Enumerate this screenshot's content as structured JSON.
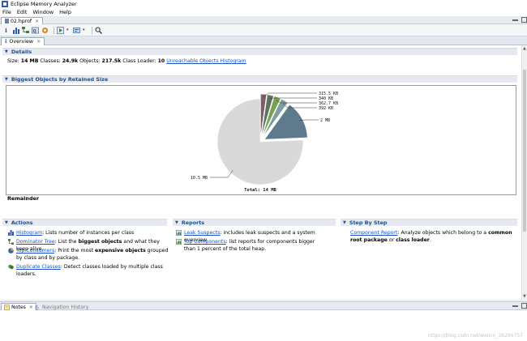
{
  "window": {
    "title": "Eclipse Memory Analyzer"
  },
  "menu": [
    "File",
    "Edit",
    "Window",
    "Help"
  ],
  "file_tab": {
    "label": "02.hprof"
  },
  "overview_tab": {
    "label": "Overview"
  },
  "details": {
    "header": "Details",
    "size_label": "Size:",
    "size_value": "14 MB",
    "classes_label": "Classes:",
    "classes_value": "24.9k",
    "objects_label": "Objects:",
    "objects_value": "217.5k",
    "loader_label": "Class Loader:",
    "loader_value": "10",
    "unreachable_link": "Unreachable Objects Histogram"
  },
  "biggest": {
    "header": "Biggest Objects by Retained Size",
    "remainder_label": "Remainder"
  },
  "chart_data": {
    "type": "pie",
    "total_label": "Total: 14 MB",
    "slices": [
      {
        "label": "10.5 MB",
        "value": 10.5,
        "color": "#d9d9d9",
        "exploded": false
      },
      {
        "label": "2 MB",
        "value": 2.0,
        "color": "#5f7a8c",
        "exploded": true
      },
      {
        "label": "392 KB",
        "value": 0.383,
        "color": "#7d9ea0",
        "exploded": true
      },
      {
        "label": "362.7 KB",
        "value": 0.354,
        "color": "#79a155",
        "exploded": true
      },
      {
        "label": "340 KB",
        "value": 0.332,
        "color": "#5c7360",
        "exploded": true
      },
      {
        "label": "315.5 KB",
        "value": 0.308,
        "color": "#7d5f6b",
        "exploded": true
      }
    ]
  },
  "actions": {
    "header": "Actions",
    "items": [
      {
        "link": "Histogram",
        "pre": ": Lists number of instances per class",
        "bold": "",
        "post": ""
      },
      {
        "link": "Dominator Tree",
        "pre": ": List the ",
        "bold": "biggest objects",
        "post": " and what they keep alive."
      },
      {
        "link": "Top Consumers",
        "pre": ": Print the most ",
        "bold": "expensive objects",
        "post": " grouped by class and by package."
      },
      {
        "link": "Duplicate Classes",
        "pre": ": Detect classes loaded by multiple class loaders.",
        "bold": "",
        "post": ""
      }
    ]
  },
  "reports": {
    "header": "Reports",
    "items": [
      {
        "link": "Leak Suspects",
        "text": ": includes leak suspects and a system overview"
      },
      {
        "link": "Top Components",
        "text": ": list reports for components bigger than 1 percent of the total heap."
      }
    ]
  },
  "steps": {
    "header": "Step By Step",
    "link": "Component Report",
    "pre": ": Analyze objects which belong to a ",
    "bold1": "common root package",
    "mid": " or ",
    "bold2": "class loader",
    "post": "."
  },
  "bottom_tabs": {
    "notes": "Notes",
    "nav_history": "Navigation History"
  },
  "watermark": "https://blog.csdn.net/weixin_38296757"
}
